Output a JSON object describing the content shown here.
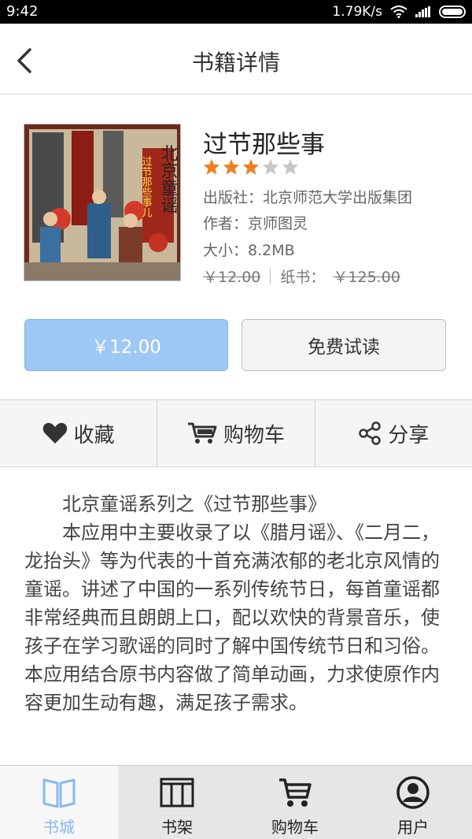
{
  "status_bar": {
    "time": "9:42",
    "network_speed": "1.79K/s"
  },
  "header": {
    "title": "书籍详情"
  },
  "book": {
    "title": "过节那些事",
    "rating": 3,
    "rating_max": 5,
    "publisher": "出版社：北京师范大学出版集团",
    "author": "作者：京师图灵",
    "size": "大小：8.2MB",
    "ebook_price": "￥12.00",
    "paper_label": "纸书：",
    "paper_price": "￥125.00",
    "cover_text": {
      "right": "北京童谣",
      "left": "过节那些事儿"
    }
  },
  "buttons": {
    "buy": "￥12.00",
    "trial": "免费试读"
  },
  "actions": {
    "favorite": "收藏",
    "cart": "购物车",
    "share": "分享"
  },
  "description": {
    "lines": [
      "北京童谣系列之《过节那些事》",
      "本应用中主要收录了以《腊月谣》、《二月二，龙抬头》等为代表的十首充满浓郁的老北京风情的童谣。讲述了中国的一系列传统节日，每首童谣都非常经典而且朗朗上口，配以欢快的背景音乐，使孩子在学习歌谣的同时了解中国传统节日和习俗。本应用结合原书内容做了简单动画，力求使原作内容更加生动有趣，满足孩子需求。"
    ]
  },
  "tabs": [
    {
      "label": "书城",
      "icon": "book-open-icon",
      "active": true
    },
    {
      "label": "书架",
      "icon": "bookshelf-icon",
      "active": false
    },
    {
      "label": "购物车",
      "icon": "cart-icon",
      "active": false
    },
    {
      "label": "用户",
      "icon": "user-icon",
      "active": false
    }
  ],
  "colors": {
    "accent": "#8ab8ec",
    "buy_button": "#9ec8f5",
    "star_on": "#f07f1e",
    "star_off": "#c8c8c8"
  }
}
